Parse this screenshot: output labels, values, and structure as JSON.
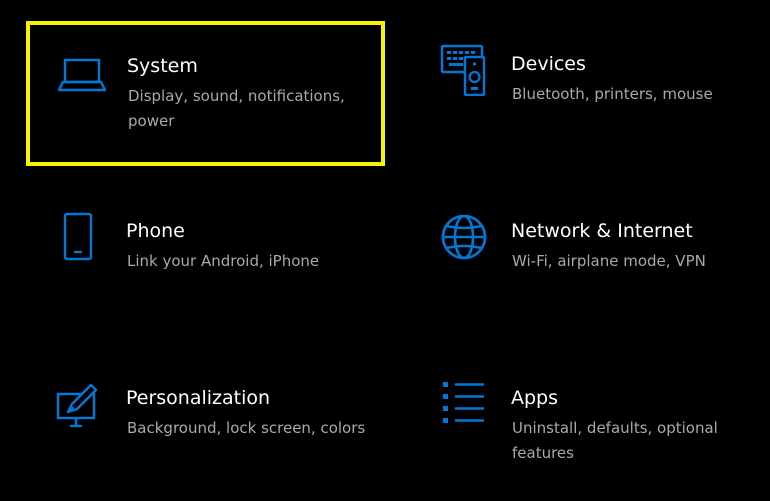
{
  "settings": {
    "accent_color": "#0078d7",
    "highlight_color": "#f8f400",
    "tiles": [
      {
        "key": "system",
        "title": "System",
        "description": "Display, sound, notifications, power",
        "icon": "laptop-icon",
        "highlighted": true
      },
      {
        "key": "devices",
        "title": "Devices",
        "description": "Bluetooth, printers, mouse",
        "icon": "devices-icon",
        "highlighted": false
      },
      {
        "key": "phone",
        "title": "Phone",
        "description": "Link your Android, iPhone",
        "icon": "phone-icon",
        "highlighted": false
      },
      {
        "key": "network",
        "title": "Network & Internet",
        "description": "Wi-Fi, airplane mode, VPN",
        "icon": "globe-icon",
        "highlighted": false
      },
      {
        "key": "personalization",
        "title": "Personalization",
        "description": "Background, lock screen, colors",
        "icon": "personalization-icon",
        "highlighted": false
      },
      {
        "key": "apps",
        "title": "Apps",
        "description": "Uninstall, defaults, optional features",
        "icon": "apps-list-icon",
        "highlighted": false
      }
    ]
  }
}
